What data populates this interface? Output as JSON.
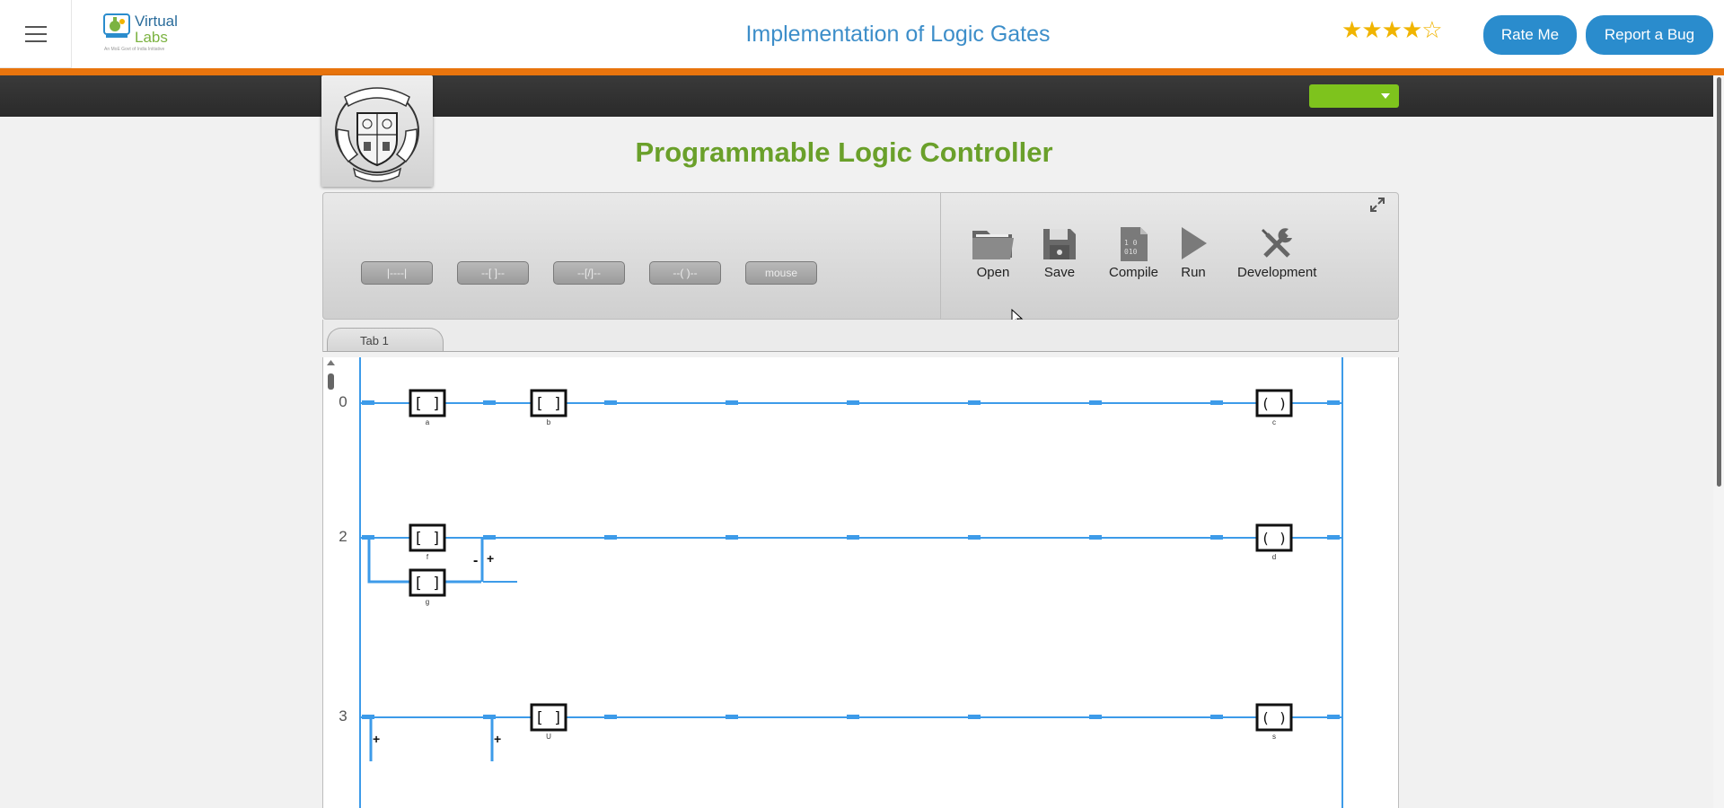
{
  "header": {
    "logo_text_1": "Virtual",
    "logo_text_2": "Labs",
    "logo_tagline": "An MoE Govt of India Initiative",
    "title": "Implementation of Logic Gates",
    "rating": 4,
    "rating_max": 5,
    "rate_label": "Rate Me",
    "bug_label": "Report a Bug"
  },
  "page": {
    "title": "Programmable Logic Controller",
    "college_seal_text": "TRUTH ENDURANCE STRENGTH COLLEGE OF ENGINEERING PUNE"
  },
  "toolbar": {
    "tools": [
      "|----|",
      "--[ ]--",
      "--[/]--",
      "--( )--",
      "mouse"
    ],
    "actions": [
      {
        "label": "Open",
        "icon": "folder-icon"
      },
      {
        "label": "Save",
        "icon": "floppy-disk-icon"
      },
      {
        "label": "Compile",
        "icon": "binary-file-icon"
      },
      {
        "label": "Run",
        "icon": "play-icon"
      },
      {
        "label": "Development",
        "icon": "wrench-screwdriver-icon"
      }
    ]
  },
  "tabs": [
    {
      "label": "Tab 1",
      "active": true
    }
  ],
  "ladder": {
    "rail_color": "#3d9be9",
    "rungs": [
      {
        "number": "0",
        "contacts": [
          "a",
          "b"
        ],
        "coil": "c"
      },
      {
        "number": "2",
        "contacts": [
          "f"
        ],
        "branch_contacts": [
          "g"
        ],
        "branch_marks": [
          "-",
          "+"
        ],
        "coil": "d"
      },
      {
        "number": "3",
        "contacts": [
          "U"
        ],
        "branch_marks": [
          "+",
          "+"
        ],
        "coil": "s"
      }
    ]
  }
}
